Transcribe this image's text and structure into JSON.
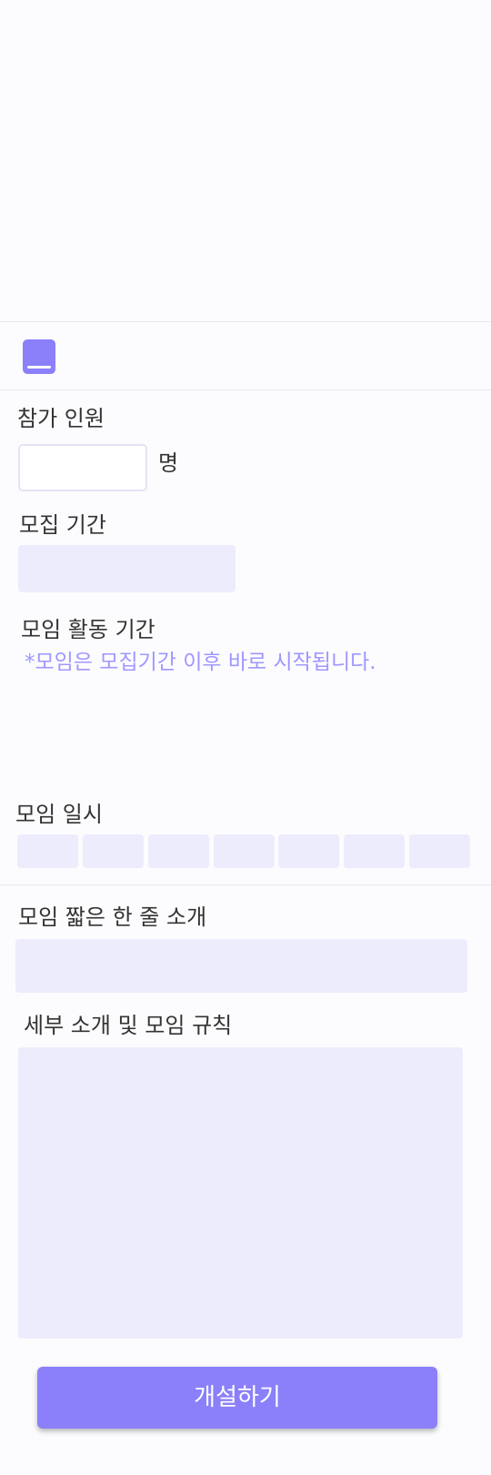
{
  "colors": {
    "accent": "#8b80f9",
    "field_bg": "#edecfc",
    "note_text": "#9f97ff"
  },
  "header": {
    "icon": "book-icon"
  },
  "participants": {
    "label": "참가 인원",
    "value": "",
    "unit": "명"
  },
  "recruit_period": {
    "label": "모집 기간",
    "value": ""
  },
  "activity_period": {
    "label": "모임 활동 기간",
    "note": "*모임은 모집기간 이후 바로 시작됩니다."
  },
  "schedule": {
    "label": "모임 일시",
    "days": [
      "",
      "",
      "",
      "",
      "",
      "",
      ""
    ]
  },
  "short_intro": {
    "label": "모임 짧은 한 줄 소개",
    "value": ""
  },
  "details": {
    "label": "세부 소개 및 모임 규칙",
    "value": ""
  },
  "submit": {
    "label": "개설하기"
  }
}
